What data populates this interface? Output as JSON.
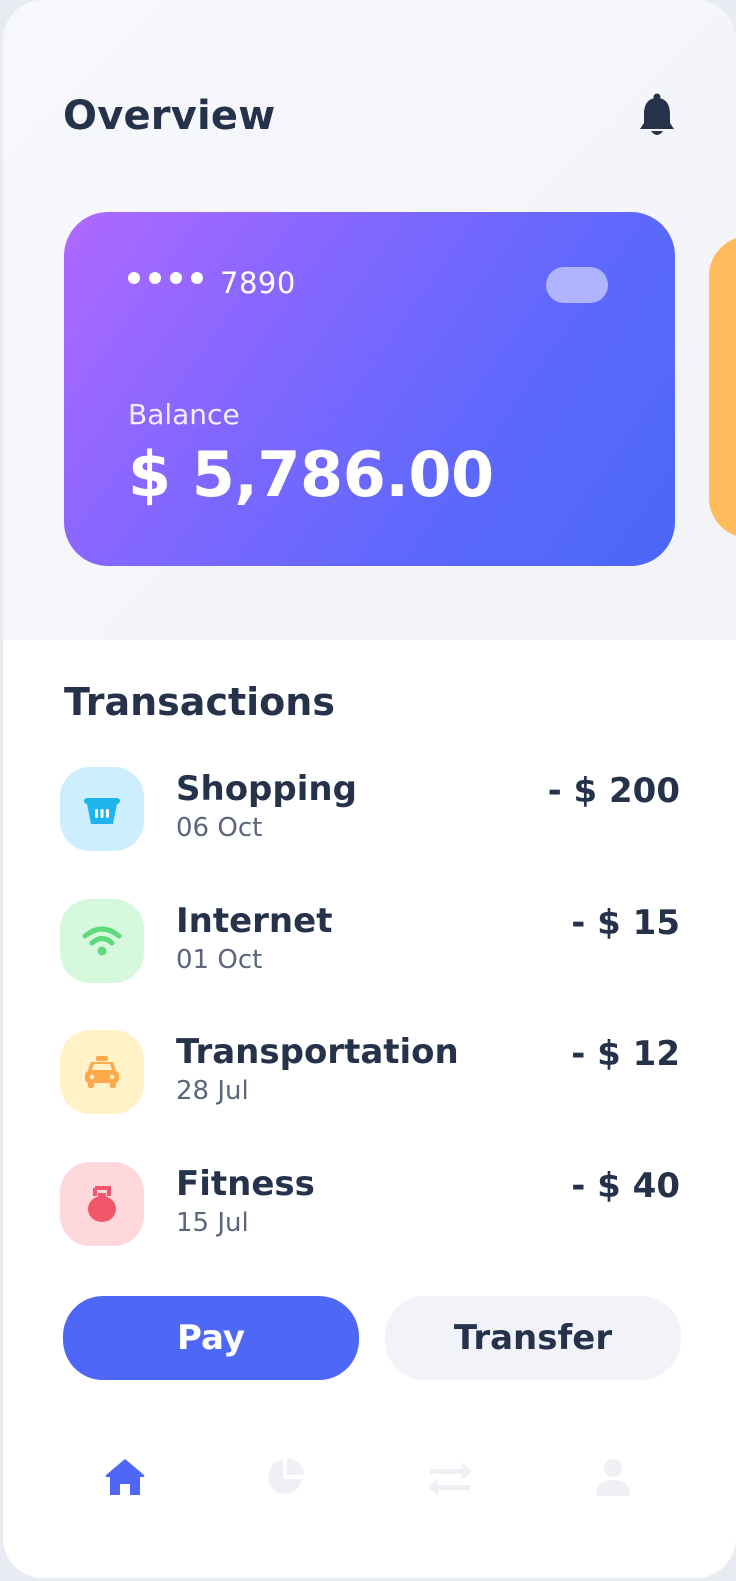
{
  "header": {
    "title": "Overview",
    "notification_icon": "bell-icon"
  },
  "card": {
    "masked_dots": "••••",
    "last_digits": "7890",
    "balance_label": "Balance",
    "balance_amount": "$ 5,786.00",
    "gradient_colors": [
      "#b068ff",
      "#4b67f8"
    ],
    "next_card_color": "#ffbb5c"
  },
  "transactions": {
    "title": "Transactions",
    "items": [
      {
        "name": "Shopping",
        "date": "06 Oct",
        "amount": "- $ 200",
        "icon": "shopping-basket-icon",
        "icon_bg": "#cdeefc",
        "icon_color": "#1fb4ec"
      },
      {
        "name": "Internet",
        "date": "01 Oct",
        "amount": "- $ 15",
        "icon": "wifi-icon",
        "icon_bg": "#d6f8dd",
        "icon_color": "#5fd97b"
      },
      {
        "name": "Transportation",
        "date": "28 Jul",
        "amount": "- $ 12",
        "icon": "taxi-icon",
        "icon_bg": "#fff2c7",
        "icon_color": "#ffa94d"
      },
      {
        "name": "Fitness",
        "date": "15 Jul",
        "amount": "- $ 40",
        "icon": "kettlebell-icon",
        "icon_bg": "#ffd8dc",
        "icon_color": "#f2566a"
      }
    ]
  },
  "actions": {
    "pay_label": "Pay",
    "transfer_label": "Transfer"
  },
  "nav": {
    "items": [
      {
        "icon": "home-icon",
        "active": true
      },
      {
        "icon": "pie-chart-icon",
        "active": false
      },
      {
        "icon": "transfer-arrows-icon",
        "active": false
      },
      {
        "icon": "user-icon",
        "active": false
      }
    ],
    "active_color": "#4e67f6",
    "inactive_color": "#eef0f6"
  }
}
